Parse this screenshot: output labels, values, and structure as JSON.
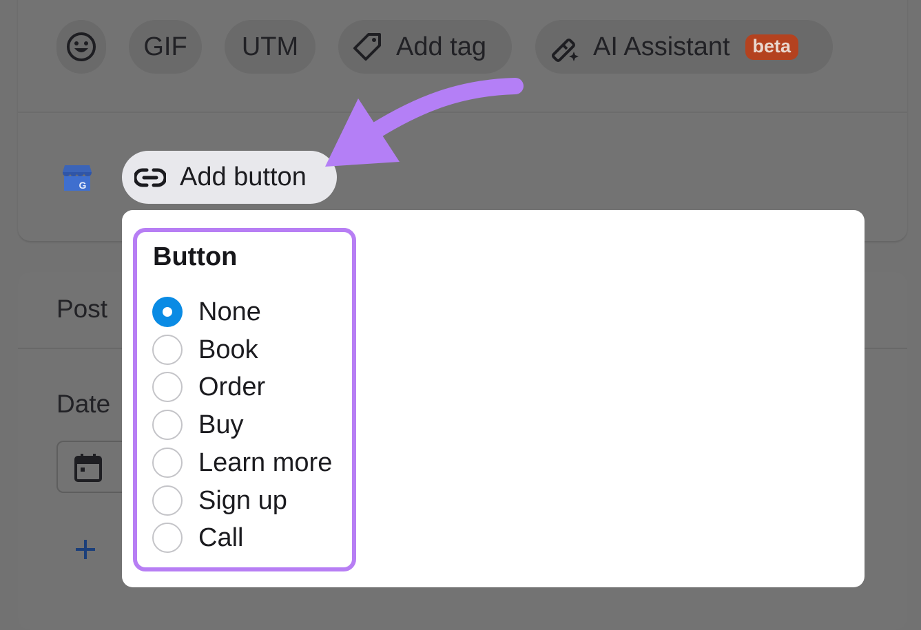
{
  "toolbar": {
    "items": [
      {
        "name": "emoji",
        "label": "",
        "icon": "smiley-icon"
      },
      {
        "name": "gif",
        "label": "GIF"
      },
      {
        "name": "utm",
        "label": "UTM"
      },
      {
        "name": "add-tag",
        "label": "Add tag",
        "icon": "tag-icon"
      },
      {
        "name": "ai-assistant",
        "label": "AI Assistant",
        "icon": "magic-wand-icon",
        "badge": "beta"
      }
    ]
  },
  "add_button": {
    "label": "Add button",
    "icon": "link-icon"
  },
  "profile_icon": "google-business-profile-icon",
  "post_section": {
    "post_label": "Post",
    "date_label": "Date",
    "calendar_icon": "calendar-icon",
    "add_icon": "plus-icon"
  },
  "button_popup": {
    "title": "Button",
    "selected": "None",
    "options": [
      {
        "label": "None",
        "checked": true
      },
      {
        "label": "Book",
        "checked": false
      },
      {
        "label": "Order",
        "checked": false
      },
      {
        "label": "Buy",
        "checked": false
      },
      {
        "label": "Learn more",
        "checked": false
      },
      {
        "label": "Sign up",
        "checked": false
      },
      {
        "label": "Call",
        "checked": false
      }
    ]
  },
  "colors": {
    "overlay": "#727272",
    "accent_purple": "#b77ef4",
    "radio_selected": "#0a8be4",
    "beta_badge": "#b4421f"
  }
}
